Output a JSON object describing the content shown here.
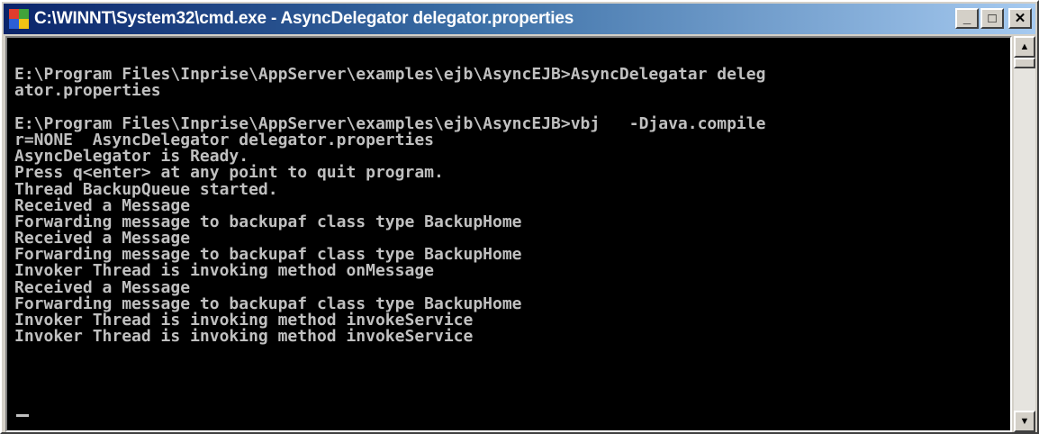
{
  "window": {
    "title": "C:\\WINNT\\System32\\cmd.exe - AsyncDelegator delegator.properties",
    "buttons": {
      "minimize": "_",
      "maximize": "□",
      "close": "✕"
    }
  },
  "console": {
    "lines": [
      "",
      "E:\\Program Files\\Inprise\\AppServer\\examples\\ejb\\AsyncEJB>AsyncDelegatar deleg",
      "ator.properties",
      "",
      "E:\\Program Files\\Inprise\\AppServer\\examples\\ejb\\AsyncEJB>vbj   -Djava.compile",
      "r=NONE  AsyncDelegator delegator.properties",
      "AsyncDelegator is Ready.",
      "Press q<enter> at any point to quit program.",
      "Thread BackupQueue started.",
      "Received a Message",
      "Forwarding message to backupaf class type BackupHome",
      "Received a Message",
      "Forwarding message to backupaf class type BackupHome",
      "Invoker Thread is invoking method onMessage",
      "Received a Message",
      "Forwarding message to backupaf class type BackupHome",
      "Invoker Thread is invoking method invokeService",
      "Invoker Thread is invoking method invokeService"
    ]
  },
  "scrollbar": {
    "up_arrow": "▲",
    "down_arrow": "▼"
  }
}
